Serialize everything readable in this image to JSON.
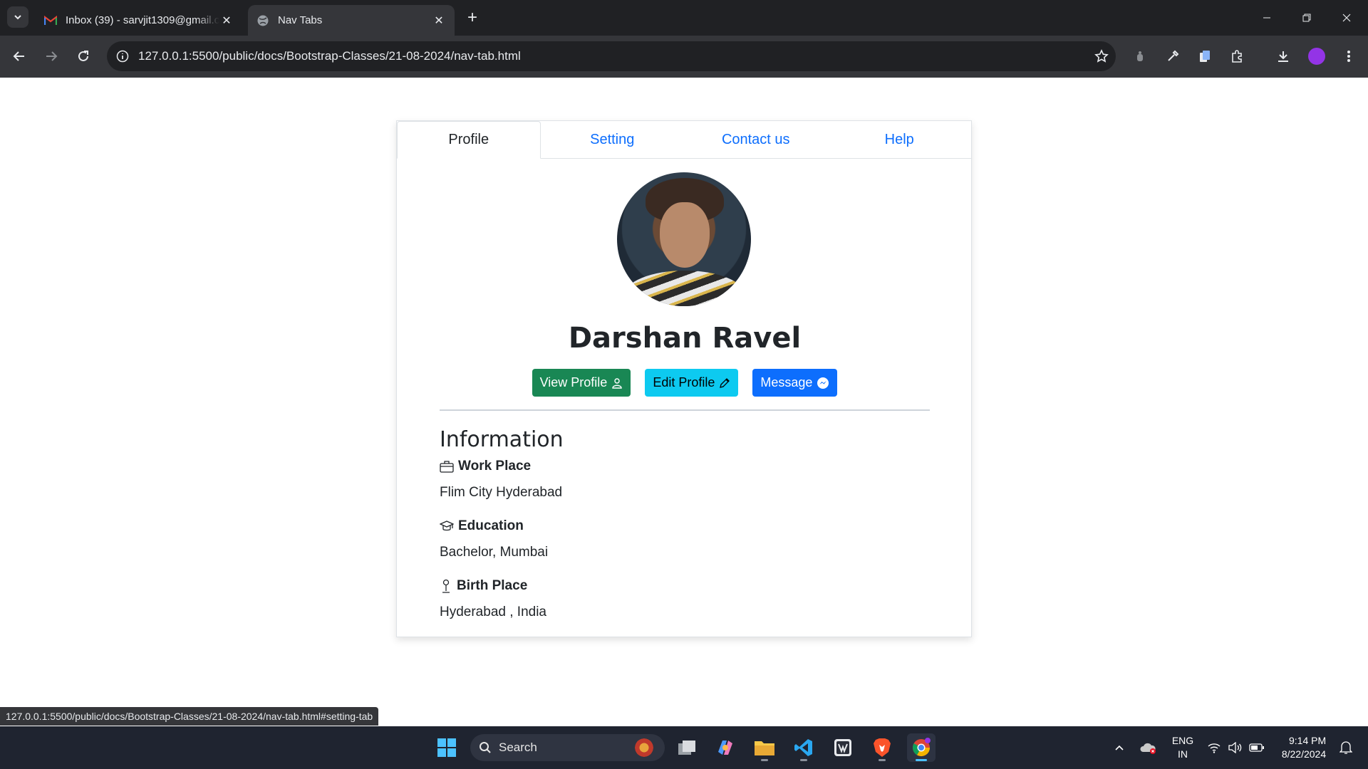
{
  "browser": {
    "tabs": [
      {
        "title": "Inbox (39) - sarvjit1309@gmail.com",
        "icon": "gmail-icon",
        "active": false
      },
      {
        "title": "Nav Tabs",
        "icon": "globe-icon",
        "active": true
      }
    ],
    "url": "127.0.0.1:5500/public/docs/Bootstrap-Classes/21-08-2024/nav-tab.html",
    "status_url": "127.0.0.1:5500/public/docs/Bootstrap-Classes/21-08-2024/nav-tab.html#setting-tab"
  },
  "page": {
    "nav_tabs": [
      {
        "label": "Profile",
        "active": true
      },
      {
        "label": "Setting",
        "active": false
      },
      {
        "label": "Contact us",
        "active": false
      },
      {
        "label": "Help",
        "active": false
      }
    ],
    "profile_name": "Darshan Ravel",
    "buttons": {
      "view_profile": "View Profile",
      "edit_profile": "Edit Profile",
      "message": "Message"
    },
    "info_title": "Information",
    "info": [
      {
        "label": "Work Place",
        "value": "Flim City Hyderabad",
        "icon": "briefcase-icon"
      },
      {
        "label": "Education",
        "value": "Bachelor, Mumbai",
        "icon": "graduation-cap-icon"
      },
      {
        "label": "Birth Place",
        "value": "Hyderabad , India",
        "icon": "person-standing-icon"
      }
    ],
    "colors": {
      "success": "#198754",
      "info": "#0dcaf0",
      "primary": "#0d6efd"
    }
  },
  "taskbar": {
    "search_placeholder": "Search",
    "language": "ENG",
    "region": "IN",
    "time": "9:14 PM",
    "date": "8/22/2024"
  }
}
